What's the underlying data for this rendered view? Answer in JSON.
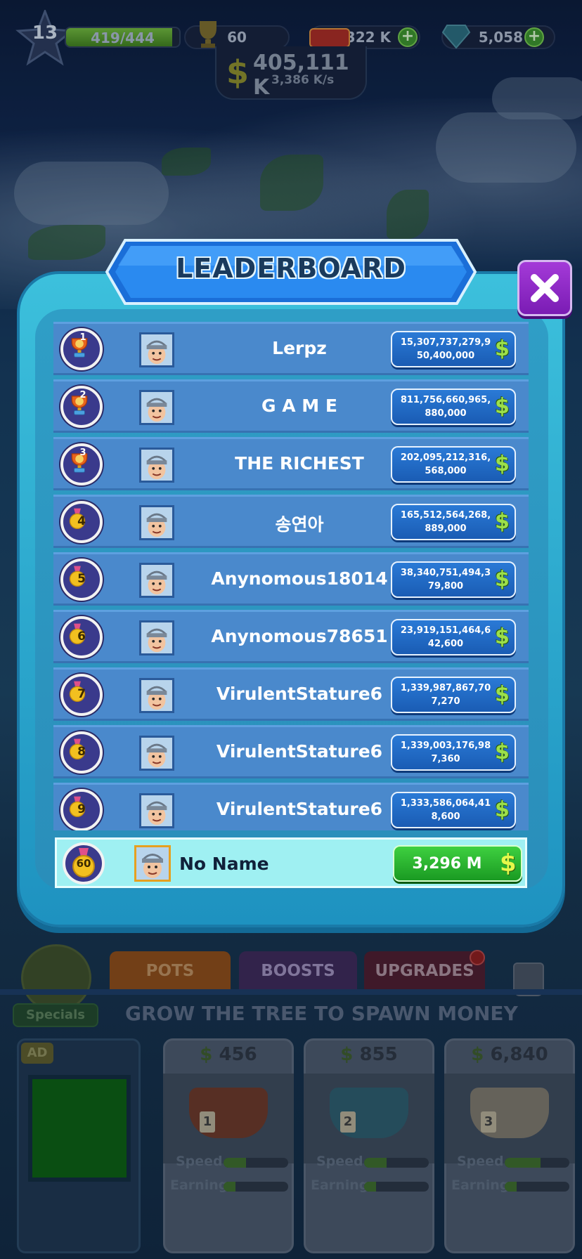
{
  "hud": {
    "level": "13",
    "xp": "419/444",
    "xp_progress": 0.94,
    "trophies": "60",
    "cash": "322 K",
    "gems": "5,058",
    "money": "405,111 K",
    "money_rate": "3,386 K/s",
    "plus": "+",
    "money_symbol": "$"
  },
  "leaderboard": {
    "title": "LEADERBOARD",
    "close_symbol": "✖",
    "rows": [
      {
        "rank": "1",
        "name": "Lerpz",
        "score": "15,307,737,279,950,400,000",
        "medal": "trophy",
        "medal_color": "#e8641c"
      },
      {
        "rank": "2",
        "name": "G A M E",
        "score": "811,756,660,965,880,000",
        "medal": "trophy",
        "medal_color": "#e8641c"
      },
      {
        "rank": "3",
        "name": "THE RICHEST",
        "score": "202,095,212,316,568,000",
        "medal": "trophy",
        "medal_color": "#e8641c"
      },
      {
        "rank": "4",
        "name": "송연아",
        "score": "165,512,564,268,889,000",
        "medal": "medal",
        "medal_color": "#f2c020"
      },
      {
        "rank": "5",
        "name": "Anynomous18014",
        "score": "38,340,751,494,379,800",
        "medal": "medal",
        "medal_color": "#f2c020"
      },
      {
        "rank": "6",
        "name": "Anynomous78651",
        "score": "23,919,151,464,642,600",
        "medal": "medal",
        "medal_color": "#f2c020"
      },
      {
        "rank": "7",
        "name": "VirulentStature6",
        "score": "1,339,987,867,707,270",
        "medal": "medal",
        "medal_color": "#f2c020"
      },
      {
        "rank": "8",
        "name": "VirulentStature6",
        "score": "1,339,003,176,987,360",
        "medal": "medal",
        "medal_color": "#f2c020"
      },
      {
        "rank": "9",
        "name": "VirulentStature6",
        "score": "1,333,586,064,418,600",
        "medal": "medal",
        "medal_color": "#f2c020"
      }
    ],
    "me": {
      "rank": "60",
      "name": "No Name",
      "score": "3,296 M"
    },
    "currency_symbol": "$"
  },
  "bottom": {
    "tabs": {
      "pots": "POTS",
      "boosts": "BOOSTS",
      "upgrades": "UPGRADES"
    },
    "specials_label": "Specials",
    "grow_text": "GROW THE TREE TO SPAWN MONEY",
    "ad_label": "AD",
    "pots": [
      {
        "price": "456",
        "number": "1",
        "color": "#6a3626",
        "speed": 0.35,
        "earning": 0.18
      },
      {
        "price": "855",
        "number": "2",
        "color": "#2c5a6a",
        "speed": 0.35,
        "earning": 0.18
      },
      {
        "price": "6,840",
        "number": "3",
        "color": "#7a7468",
        "speed": 0.55,
        "earning": 0.18
      }
    ],
    "speed_label": "Speed",
    "earning_label": "Earning"
  }
}
